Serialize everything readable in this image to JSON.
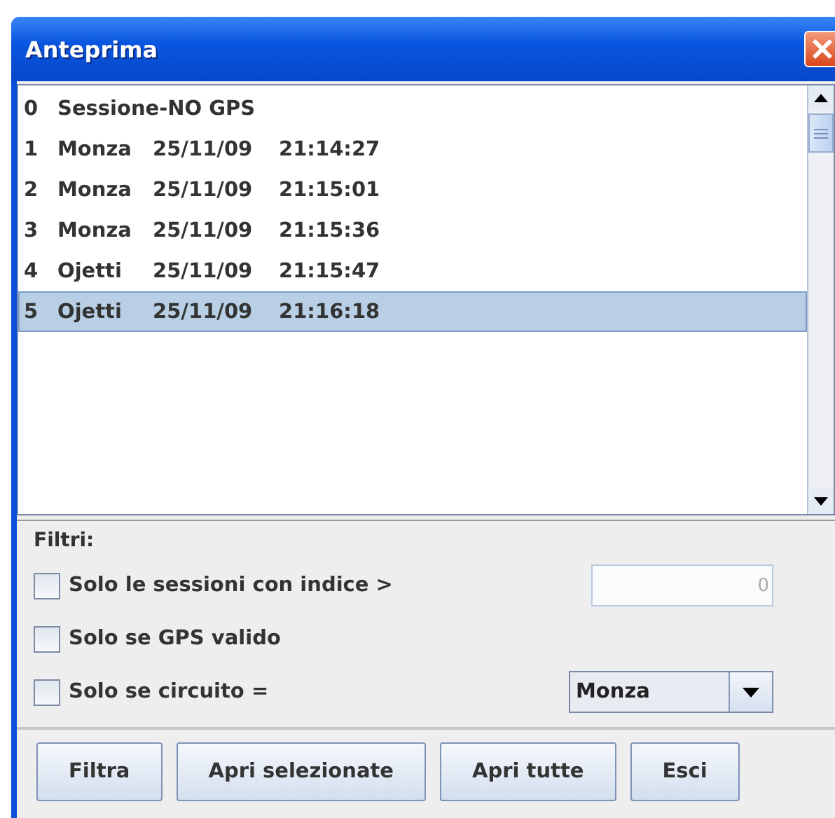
{
  "window": {
    "title": "Anteprima"
  },
  "sessions": [
    {
      "index": "0",
      "name": "Sessione-NO GPS",
      "selected": false
    },
    {
      "index": "1",
      "name": "Monza",
      "date": "25/11/09",
      "time": "21:14:27",
      "selected": false
    },
    {
      "index": "2",
      "name": "Monza",
      "date": "25/11/09",
      "time": "21:15:01",
      "selected": false
    },
    {
      "index": "3",
      "name": "Monza",
      "date": "25/11/09",
      "time": "21:15:36",
      "selected": false
    },
    {
      "index": "4",
      "name": "Ojetti",
      "date": "25/11/09",
      "time": "21:15:47",
      "selected": false
    },
    {
      "index": "5",
      "name": "Ojetti",
      "date": "25/11/09",
      "time": "21:16:18",
      "selected": true
    }
  ],
  "filters": {
    "title": "Filtri:",
    "options": [
      {
        "kind": "field",
        "label": "Solo le sessioni con indice >",
        "checked": false,
        "value": "0"
      },
      {
        "kind": "plain",
        "label": "Solo se GPS valido",
        "checked": false
      },
      {
        "kind": "select",
        "label": "Solo se circuito =",
        "checked": false,
        "value": "Monza"
      }
    ]
  },
  "buttons": [
    "Filtra",
    "Apri selezionate",
    "Apri tutte",
    "Esci"
  ]
}
